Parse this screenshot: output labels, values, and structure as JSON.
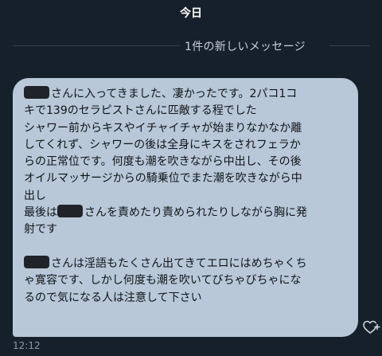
{
  "header": {
    "date_label": "今日"
  },
  "divider": {
    "label": "1件の新しいメッセージ"
  },
  "message": {
    "lines": [
      "さんに入ってきました、凄かったです。2パコ1コ",
      "キで139のセラピストさんに匹敵する程でした",
      "シャワー前からキスやイチャイチャが始まりなかなか離",
      "してくれず、シャワーの後は全身にキスをされフェラか",
      "らの正常位です。何度も潮を吹きながら中出し、その後",
      "オイルマッサージからの騎乗位でまた潮を吹きながら中",
      "出し",
      "最後は",
      "さんを責めたり責められたりしながら胸に発",
      "射です",
      "さんは淫語もたくさん出てきてエロにはめちゃくち",
      "ゃ寛容です、しかし何度も潮を吹いてびちゃびちゃにな",
      "るので気になる人は注意して下さい"
    ],
    "timestamp": "12:12"
  },
  "icons": {
    "reaction": "heart-plus-icon"
  },
  "colors": {
    "background": "#15202b",
    "bubble": "#b8c8d8",
    "bubble_text": "#0f1419",
    "redaction": "#202428",
    "muted_text": "#8b98a5"
  }
}
